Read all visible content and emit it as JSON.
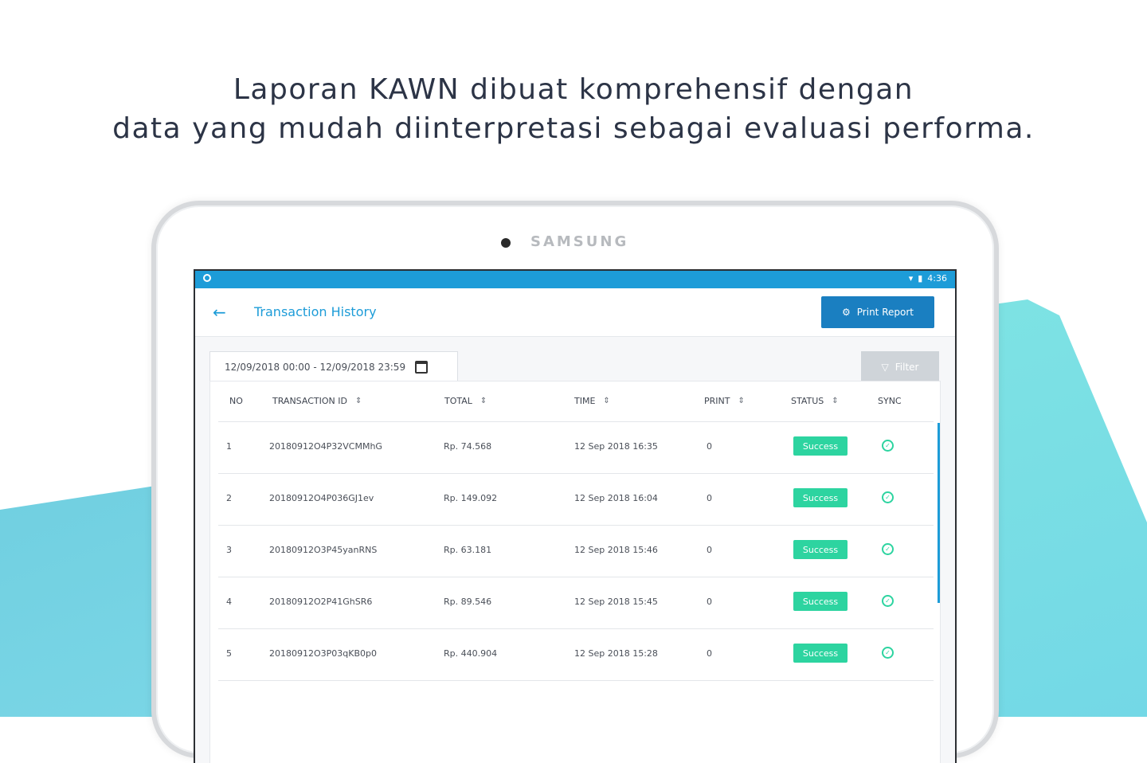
{
  "headline": {
    "line1": "Laporan KAWN dibuat komprehensif dengan",
    "line2": "data yang mudah diinterpretasi sebagai evaluasi performa."
  },
  "device": {
    "brand": "SAMSUNG"
  },
  "statusbar": {
    "time": "4:36"
  },
  "appbar": {
    "title": "Transaction History",
    "print_label": "Print Report"
  },
  "toolbar": {
    "date_range": "12/09/2018 00:00 - 12/09/2018 23:59",
    "filter_label": "Filter"
  },
  "table": {
    "headers": [
      "NO",
      "TRANSACTION ID",
      "TOTAL",
      "TIME",
      "PRINT",
      "STATUS",
      "SYNC"
    ],
    "rows": [
      {
        "no": "1",
        "id": "20180912O4P32VCMMhG",
        "total": "Rp. 74.568",
        "time": "12 Sep 2018 16:35",
        "print": "0",
        "status": "Success"
      },
      {
        "no": "2",
        "id": "20180912O4P036GJ1ev",
        "total": "Rp. 149.092",
        "time": "12 Sep 2018 16:04",
        "print": "0",
        "status": "Success"
      },
      {
        "no": "3",
        "id": "20180912O3P45yanRNS",
        "total": "Rp. 63.181",
        "time": "12 Sep 2018 15:46",
        "print": "0",
        "status": "Success"
      },
      {
        "no": "4",
        "id": "20180912O2P41GhSR6",
        "total": "Rp. 89.546",
        "time": "12 Sep 2018 15:45",
        "print": "0",
        "status": "Success"
      },
      {
        "no": "5",
        "id": "20180912O3P03qKB0p0",
        "total": "Rp. 440.904",
        "time": "12 Sep 2018 15:28",
        "print": "0",
        "status": "Success"
      }
    ]
  },
  "colors": {
    "primary": "#1d9cd8",
    "button": "#1a7fc1",
    "success": "#2dd4a0",
    "headline": "#2c3446"
  },
  "icons": {
    "back": "arrow-left-icon",
    "print": "gear-icon",
    "filter": "filter-icon",
    "calendar": "calendar-icon",
    "sort": "sort-icon",
    "sync": "check-circle-icon",
    "wifi": "wifi-icon",
    "battery": "battery-icon"
  }
}
